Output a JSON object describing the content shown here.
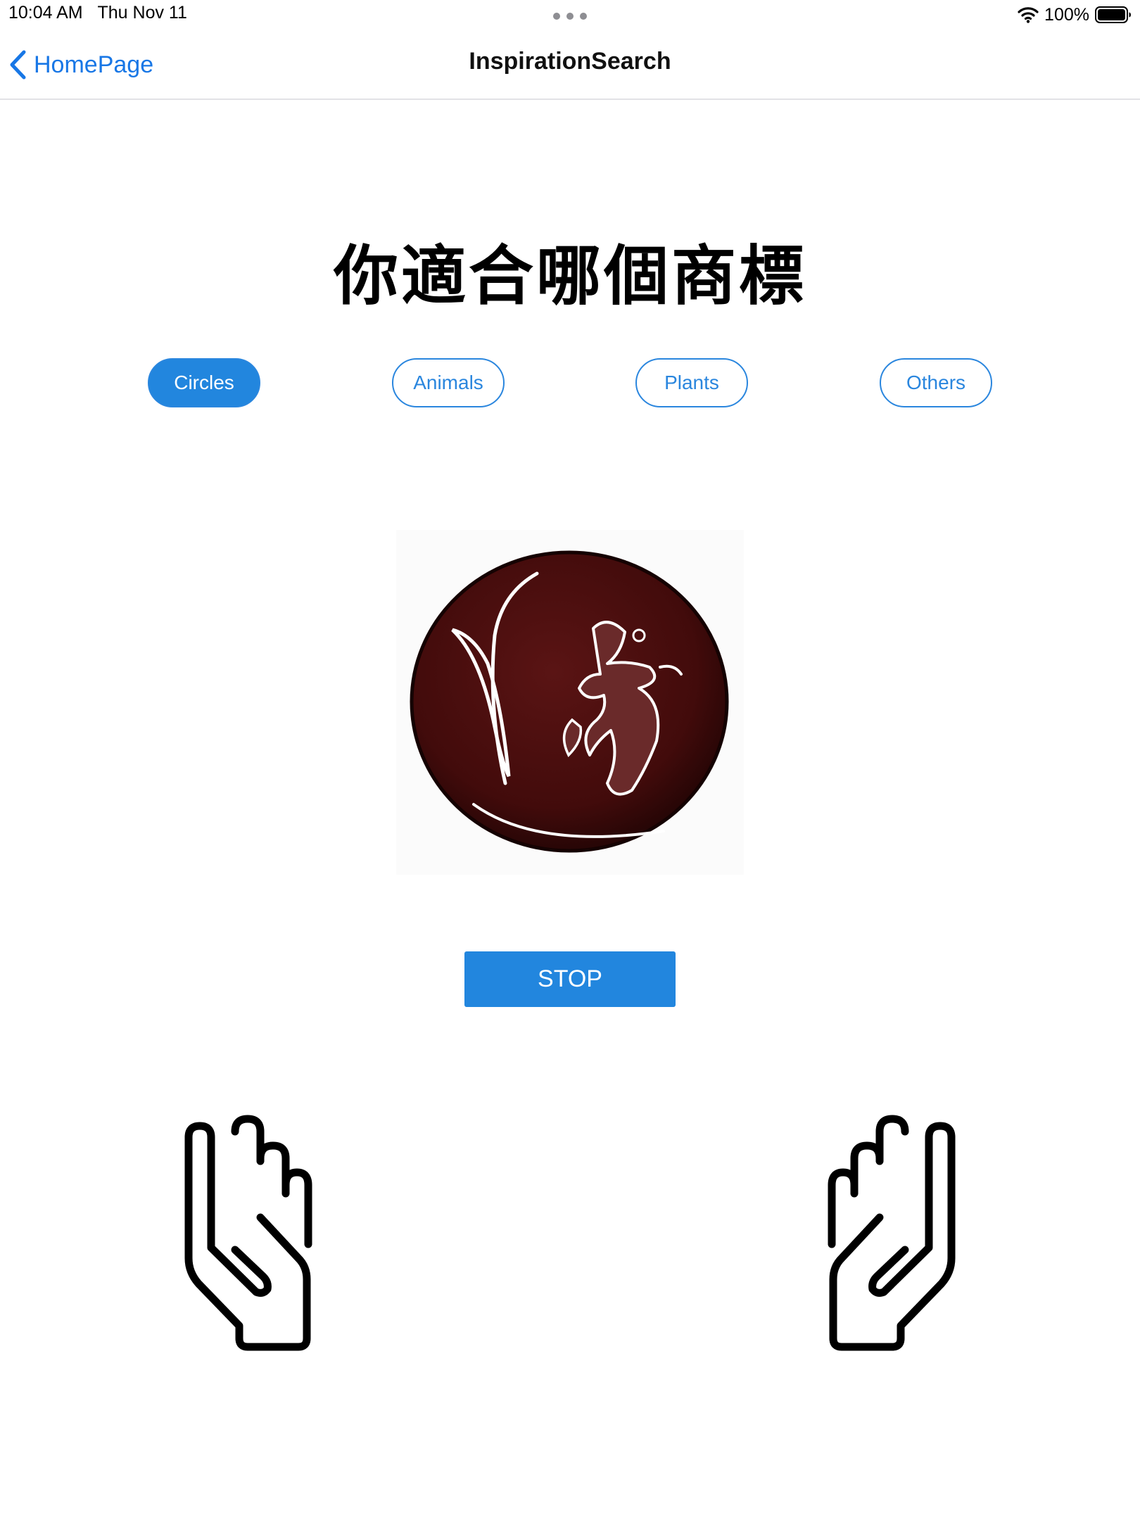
{
  "status_bar": {
    "time": "10:04 AM",
    "date": "Thu Nov 11",
    "battery_percent": "100%",
    "icons": [
      "wifi-icon",
      "battery-icon"
    ]
  },
  "nav": {
    "back_label": "HomePage",
    "title": "InspirationSearch",
    "back_icon": "chevron-left-icon"
  },
  "heading": "你適合哪個商標",
  "categories": [
    {
      "label": "Circles",
      "selected": true
    },
    {
      "label": "Animals",
      "selected": false
    },
    {
      "label": "Plants",
      "selected": false
    },
    {
      "label": "Others",
      "selected": false
    }
  ],
  "logo": {
    "icon": "circular-logo-image",
    "colors": {
      "disc": "#4a0d0d",
      "stroke": "#ffffff"
    }
  },
  "stop_button": {
    "label": "STOP"
  },
  "gestures": {
    "left_icon": "left-hand-icon",
    "right_icon": "right-hand-icon"
  },
  "colors": {
    "accent": "#2286de",
    "link": "#1877e6"
  }
}
